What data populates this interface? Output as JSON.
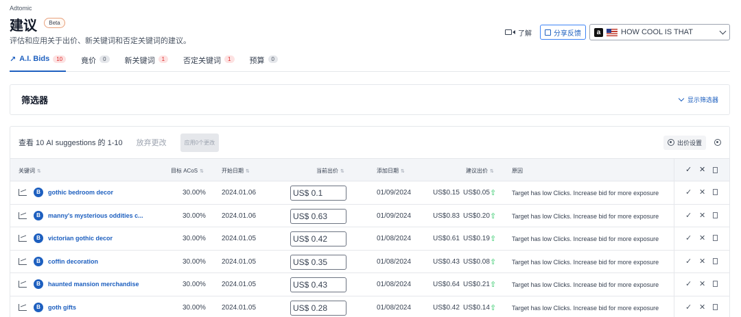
{
  "app_name": "Adtomic",
  "page_title": "建议",
  "beta_label": "Beta",
  "subtitle": "评估和应用关于出价、新关键词和否定关键词的建议。",
  "header": {
    "learn_label": "了解",
    "feedback_label": "分享反馈",
    "store_name": "HOW COOL IS THAT"
  },
  "tabs": [
    {
      "label": "A.I. Bids",
      "count": "10",
      "badge": "red"
    },
    {
      "label": "竟价",
      "count": "0",
      "badge": "grey"
    },
    {
      "label": "新关键词",
      "count": "1",
      "badge": "red"
    },
    {
      "label": "否定关键词",
      "count": "1",
      "badge": "red"
    },
    {
      "label": "预算",
      "count": "0",
      "badge": "grey"
    }
  ],
  "filters": {
    "title": "筛选器",
    "show_label": "显示筛选器"
  },
  "toolbar": {
    "results_text": "查看 10 AI suggestions 的 1-10",
    "discard_label": "放弃更改",
    "apply_label": "应用0个更改",
    "bid_settings_label": "出价设置"
  },
  "columns": {
    "keyword": "关键词",
    "target_acos": "目标 ACoS",
    "start_date": "开始日期",
    "current_bid": "当前出价",
    "added_date": "添加日期",
    "suggested_bid": "建议出价",
    "reason": "原因"
  },
  "rows": [
    {
      "badge": "B",
      "keyword": "gothic bedroom decor",
      "acos": "30.00%",
      "start": "2024.01.06",
      "bid": "US$ 0.1",
      "added": "01/09/2024",
      "from": "US$0.15",
      "to": "US$0.05",
      "reason": "Target has low Clicks. Increase bid for more exposure"
    },
    {
      "badge": "B",
      "keyword": "manny's mysterious oddities c...",
      "acos": "30.00%",
      "start": "2024.01.06",
      "bid": "US$ 0.63",
      "added": "01/09/2024",
      "from": "US$0.83",
      "to": "US$0.20",
      "reason": "Target has low Clicks. Increase bid for more exposure"
    },
    {
      "badge": "B",
      "keyword": "victorian gothic decor",
      "acos": "30.00%",
      "start": "2024.01.05",
      "bid": "US$ 0.42",
      "added": "01/08/2024",
      "from": "US$0.61",
      "to": "US$0.19",
      "reason": "Target has low Clicks. Increase bid for more exposure"
    },
    {
      "badge": "B",
      "keyword": "coffin decoration",
      "acos": "30.00%",
      "start": "2024.01.05",
      "bid": "US$ 0.35",
      "added": "01/08/2024",
      "from": "US$0.43",
      "to": "US$0.08",
      "reason": "Target has low Clicks. Increase bid for more exposure"
    },
    {
      "badge": "B",
      "keyword": "haunted mansion merchandise",
      "acos": "30.00%",
      "start": "2024.01.05",
      "bid": "US$ 0.43",
      "added": "01/08/2024",
      "from": "US$0.64",
      "to": "US$0.21",
      "reason": "Target has low Clicks. Increase bid for more exposure"
    },
    {
      "badge": "B",
      "keyword": "goth gifts",
      "acos": "30.00%",
      "start": "2024.01.05",
      "bid": "US$ 0.28",
      "added": "01/08/2024",
      "from": "US$0.42",
      "to": "US$0.14",
      "reason": "Target has low Clicks. Increase bid for more exposure"
    }
  ],
  "colors": {
    "accent": "#1d5fbf",
    "up_arrow": "#22c55e",
    "badge_red": "#dc2626"
  }
}
